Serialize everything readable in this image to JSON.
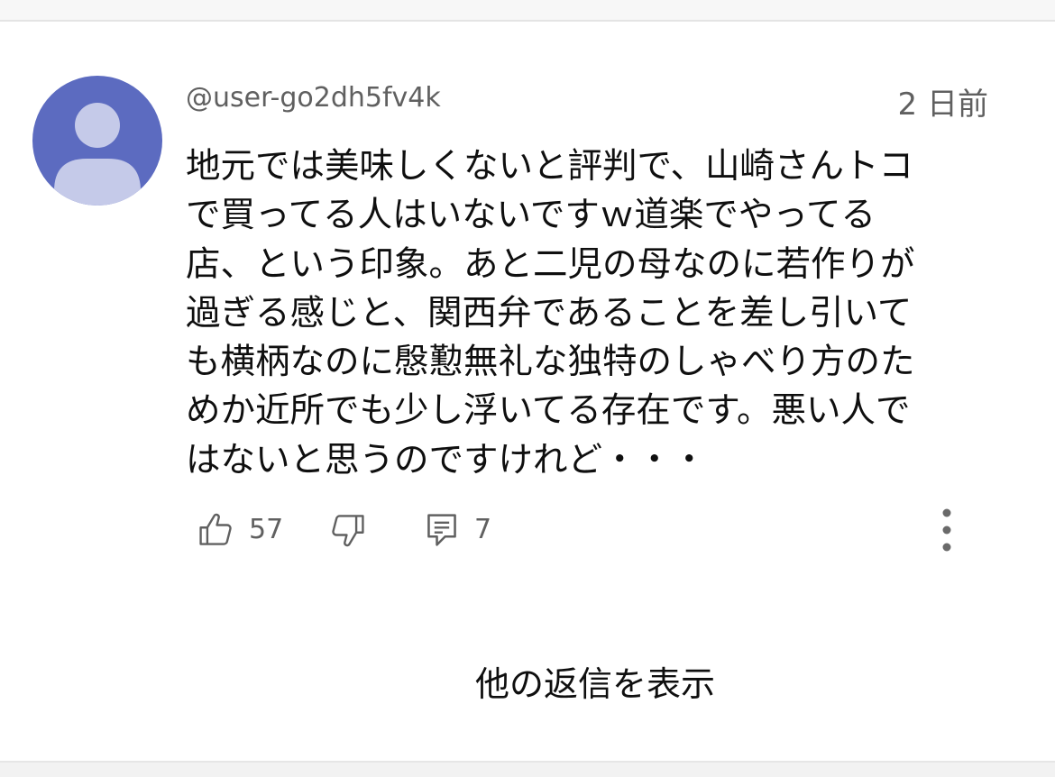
{
  "comment": {
    "author": "@user-go2dh5fv4k",
    "timestamp": "2 日前",
    "text": "地元では美味しくないと評判で、山崎さんトコ\nで買ってる人はいないですｗ道楽でやってる\n店、という印象。あと二児の母なのに若作りが\n過ぎる感じと、関西弁であることを差し引いて\nも横柄なのに慇懃無礼な独特のしゃべり方のた\nめか近所でも少し浮いてる存在です。悪い人で\nはないと思うのですけれど・・・",
    "avatar_icon": "default-user-avatar-icon",
    "avatar_color": "#5c6bc0"
  },
  "actions": {
    "like_count": "57",
    "reply_count": "7",
    "like_icon": "thumb-up-icon",
    "dislike_icon": "thumb-down-icon",
    "reply_icon": "comment-reply-icon",
    "more_icon": "more-vertical-icon"
  },
  "show_more_replies_label": "他の返信を表示"
}
